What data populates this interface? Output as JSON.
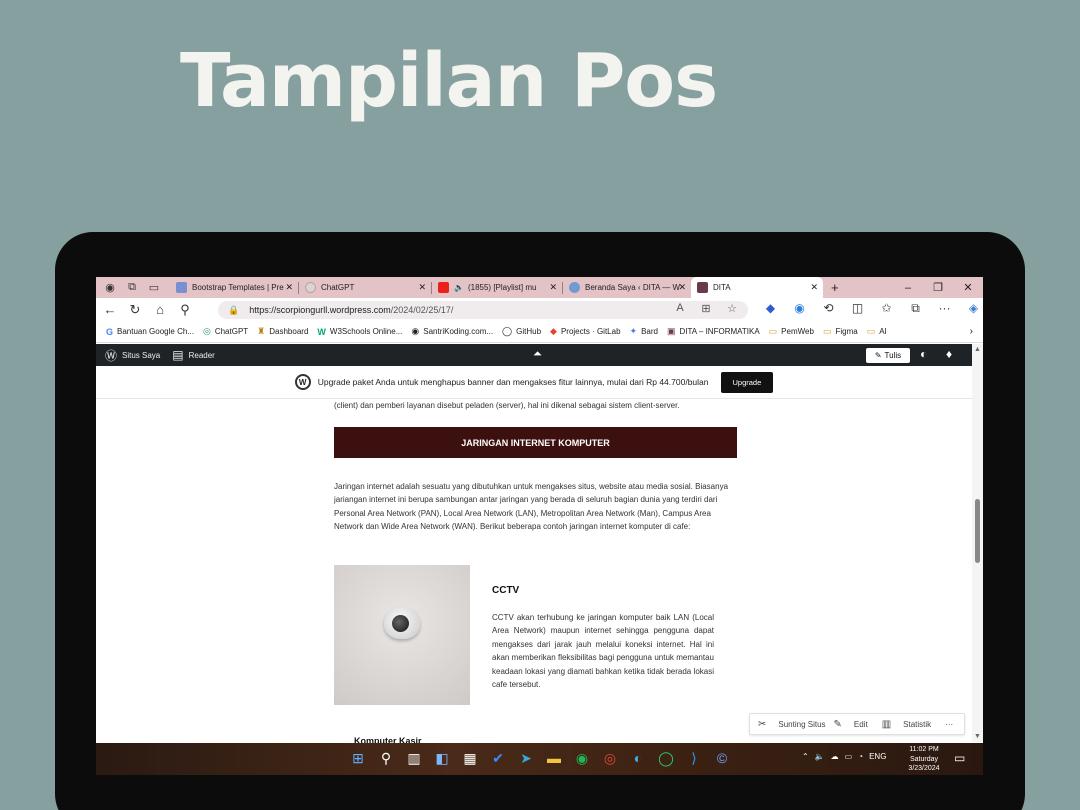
{
  "slide_title": "Tampilan Pos",
  "browser": {
    "tabs": [
      {
        "label": "Bootstrap Templates | Pre",
        "color": "#7a8fcf"
      },
      {
        "label": "ChatGPT",
        "color": "#e2d0d2"
      },
      {
        "label": "(1855) [Playlist] mu",
        "color": "#e8211b"
      },
      {
        "label": "Beranda Saya ‹ DITA — W",
        "color": "#6f9bd1"
      },
      {
        "label": "DITA",
        "color": "#6a3a4a"
      }
    ],
    "url_host": "https://scorpiongurll.wordpress.com",
    "url_path": "/2024/02/25/17/",
    "bookmarks": [
      {
        "label": "Bantuan Google Ch...",
        "icon": "G"
      },
      {
        "label": "ChatGPT",
        "icon": "◎"
      },
      {
        "label": "Dashboard",
        "icon": "♜"
      },
      {
        "label": "W3Schools Online...",
        "icon": "W"
      },
      {
        "label": "SantriKoding.com...",
        "icon": "◉"
      },
      {
        "label": "GitHub",
        "icon": "◯"
      },
      {
        "label": "Projects · GitLab",
        "icon": "◆"
      },
      {
        "label": "Bard",
        "icon": "✦"
      },
      {
        "label": "DITA – INFORMATIKA",
        "icon": "▣"
      },
      {
        "label": "PemWeb",
        "icon": "▭"
      },
      {
        "label": "Figma",
        "icon": "▭"
      },
      {
        "label": "AI",
        "icon": "▭"
      }
    ]
  },
  "wp_admin": {
    "site_label": "Situs Saya",
    "reader_label": "Reader",
    "write_label": "Tulis"
  },
  "banner": {
    "text": "Upgrade paket Anda untuk menghapus banner dan mengakses fitur lainnya, mulai dari Rp 44.700/bulan",
    "button": "Upgrade"
  },
  "post": {
    "intro_tail": "(client) dan pemberi layanan disebut peladen (server), hal ini dikenal sebagai sistem client-server.",
    "section_heading": "JARINGAN INTERNET KOMPUTER",
    "section_text": "Jaringan internet adalah sesuatu yang dibutuhkan untuk mengakses situs, website atau media sosial. Biasanya jariangan internet ini berupa sambungan antar jaringan yang berada di seluruh bagian dunia yang terdiri dari Personal Area Network (PAN), Local Area Network (LAN), Metropolitan Area Network (Man), Campus Area Network dan Wide Area Network (WAN). Berikut beberapa contoh jaringan internet komputer di cafe:",
    "cctv_title": "CCTV",
    "cctv_text": "CCTV akan terhubung ke jaringan komputer baik LAN (Local Area Network) maupun internet sehingga pengguna dapat mengakses dari jarak jauh melalui koneksi internet. Hal ini akan memberikan fleksibilitas bagi pengguna untuk memantau keadaan lokasi yang diamati bahkan ketika tidak berada lokasi cafe tersebut.",
    "next_title": "Komputer Kasir"
  },
  "float_toolbar": {
    "customize": "Sunting Situs",
    "edit": "Edit",
    "stats": "Statistik"
  },
  "taskbar": {
    "lang": "ENG",
    "time": "11:02 PM",
    "day": "Saturday",
    "date": "3/23/2024"
  }
}
